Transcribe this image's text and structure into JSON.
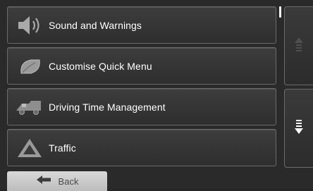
{
  "menu": {
    "items": [
      {
        "label": "Sound and Warnings",
        "icon": "speaker-icon"
      },
      {
        "label": "Customise Quick Menu",
        "icon": "quick-menu-leaf-icon"
      },
      {
        "label": "Driving Time Management",
        "icon": "truck-icon"
      },
      {
        "label": "Traffic",
        "icon": "traffic-triangle-icon"
      }
    ]
  },
  "navigation": {
    "back_label": "Back"
  },
  "colors": {
    "background": "#2a2a2a",
    "item_border": "#6b6b6b",
    "text": "#ffffff",
    "back_button": "#cfcfcf"
  }
}
